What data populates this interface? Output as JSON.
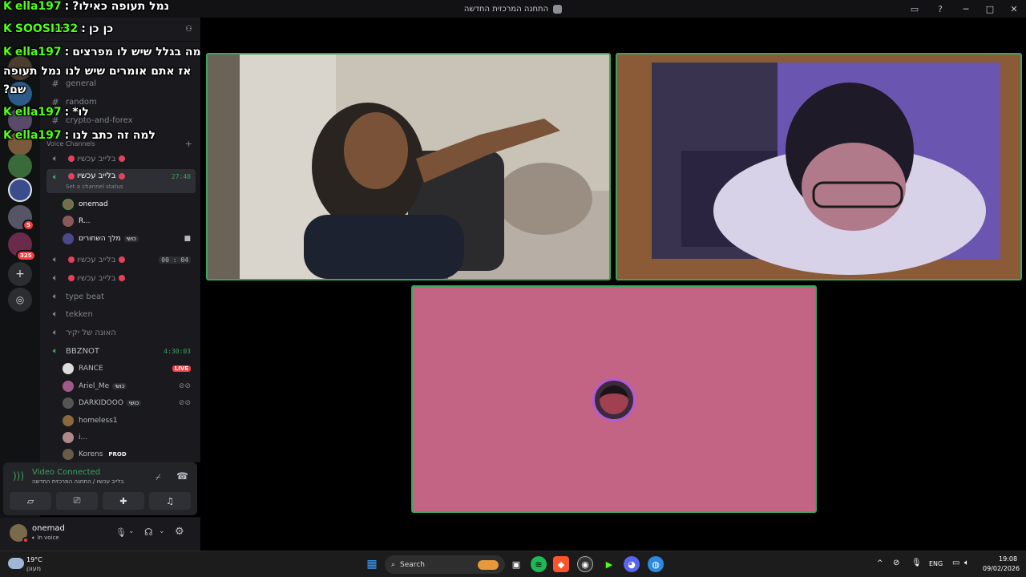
{
  "window": {
    "title": "התחנה המרכזית החדשה"
  },
  "server": {
    "name": "התחנה..."
  },
  "categories": {
    "voice": "Voice Channels"
  },
  "text_channels": [
    {
      "name": "general"
    },
    {
      "name": "random"
    },
    {
      "name": "crypto-and-forex"
    }
  ],
  "voice_channels": [
    {
      "name": "בלייב עכשיו"
    },
    {
      "name": "בלייב עכשיו",
      "timer": "27:40",
      "status": "Set a channel status"
    },
    {
      "name": "בלייב עכשיו",
      "timer": "00 : 04"
    },
    {
      "name": "בלייב עכשיו"
    },
    {
      "name": "type beat"
    },
    {
      "name": "tekken"
    },
    {
      "name": "האונה של יקיר"
    },
    {
      "name": "BBZNOT",
      "timer": "4:30:03"
    }
  ],
  "voice_users_1": [
    {
      "name": "onemad"
    },
    {
      "name": "R..."
    },
    {
      "name": "מלך השחורים",
      "tag": "כושי"
    }
  ],
  "voice_users_2": [
    {
      "name": "RANCE",
      "badge": "LIVE"
    },
    {
      "name": "Ariel_Me",
      "tag": "כושי"
    },
    {
      "name": "DARKIDOOO",
      "tag": "כושי"
    },
    {
      "name": "homeless1"
    },
    {
      "name": "i..."
    },
    {
      "name": "Korens",
      "tag": "PROD"
    }
  ],
  "rail_badges": [
    "5",
    "325"
  ],
  "voice_panel": {
    "status": "Video Connected",
    "subtitle": "בלייב עכשיו / התחנה המרכזית החדשה"
  },
  "user_panel": {
    "username": "onemad",
    "status": "In voice"
  },
  "chat_overlay": [
    {
      "user": "ella197",
      "text": "נמל תעופה כאילו?"
    },
    {
      "user": "SOOSI132",
      "text": "כן כן"
    },
    {
      "user": "ella197",
      "text": "מה בגלל שיש לו מפרצים"
    },
    {
      "user": "",
      "text": "אז אתם אומרים שיש לנו נמל תעופה"
    },
    {
      "user": "",
      "text": "שם?"
    },
    {
      "user": "ella197",
      "text": "לו*"
    },
    {
      "user": "ella197",
      "text": "למה זה כתב לנו"
    }
  ],
  "taskbar": {
    "weather_temp": "19°C",
    "weather_desc": "מעונן",
    "search": "Search",
    "language": "ENG",
    "time": "19:08",
    "date": "09/02/2026"
  },
  "colors": {
    "tile_speaking_border": "#3ba55c",
    "tile2_bg": "#8b5a36",
    "tile3_bg": "#c46485",
    "kick_green": "#53fc18",
    "live_red": "#f23f43"
  }
}
